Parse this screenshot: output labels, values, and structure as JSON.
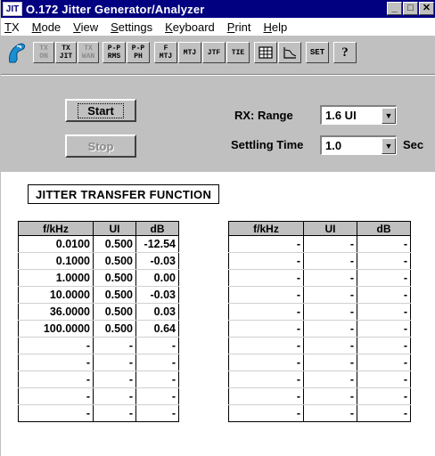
{
  "window": {
    "app_icon_text": "JIT",
    "title": "O.172 Jitter Generator/Analyzer",
    "controls": {
      "minimize": "_",
      "maximize": "□",
      "close": "✕"
    }
  },
  "menu": [
    {
      "label": "TX",
      "key": "T",
      "rest": "X"
    },
    {
      "label": "Mode",
      "key": "M",
      "rest": "ode"
    },
    {
      "label": "View",
      "key": "V",
      "rest": "iew"
    },
    {
      "label": "Settings",
      "key": "S",
      "rest": "ettings"
    },
    {
      "label": "Keyboard",
      "key": "K",
      "rest": "eyboard"
    },
    {
      "label": "Print",
      "key": "P",
      "rest": "rint"
    },
    {
      "label": "Help",
      "key": "H",
      "rest": "elp"
    }
  ],
  "toolbar": {
    "buttons": [
      {
        "label": "TX\nON",
        "enabled": false
      },
      {
        "label": "TX\nJIT",
        "enabled": true
      },
      {
        "label": "TX\nWAN",
        "enabled": false
      },
      {
        "label": "P-P\nRMS",
        "enabled": true
      },
      {
        "label": "P-P\nPH",
        "enabled": true
      },
      {
        "label": "F\nMTJ",
        "enabled": true
      },
      {
        "label": "MTJ",
        "enabled": true
      },
      {
        "label": "JTF",
        "enabled": true
      },
      {
        "label": "TIE",
        "enabled": true
      },
      {
        "label": "SET",
        "enabled": true
      },
      {
        "label": "?",
        "enabled": true
      }
    ],
    "icons": [
      "logo-icon",
      "grid-icon",
      "graph-icon",
      "help-icon"
    ]
  },
  "controls": {
    "start_label": "Start",
    "stop_label": "Stop",
    "rx_range_label": "RX: Range",
    "rx_range_value": "1.6 UI",
    "settling_label": "Settling Time",
    "settling_value": "1.0",
    "settling_unit": "Sec"
  },
  "section_title": "JITTER TRANSFER FUNCTION",
  "table_left": {
    "headers": [
      "f/kHz",
      "UI",
      "dB"
    ],
    "rows": [
      [
        "0.0100",
        "0.500",
        "-12.54"
      ],
      [
        "0.1000",
        "0.500",
        "-0.03"
      ],
      [
        "1.0000",
        "0.500",
        "0.00"
      ],
      [
        "10.0000",
        "0.500",
        "-0.03"
      ],
      [
        "36.0000",
        "0.500",
        "0.03"
      ],
      [
        "100.0000",
        "0.500",
        "0.64"
      ],
      [
        "-",
        "-",
        "-"
      ],
      [
        "-",
        "-",
        "-"
      ],
      [
        "-",
        "-",
        "-"
      ],
      [
        "-",
        "-",
        "-"
      ],
      [
        "-",
        "-",
        "-"
      ]
    ]
  },
  "table_right": {
    "headers": [
      "f/kHz",
      "UI",
      "dB"
    ],
    "rows": [
      [
        "-",
        "-",
        "-"
      ],
      [
        "-",
        "-",
        "-"
      ],
      [
        "-",
        "-",
        "-"
      ],
      [
        "-",
        "-",
        "-"
      ],
      [
        "-",
        "-",
        "-"
      ],
      [
        "-",
        "-",
        "-"
      ],
      [
        "-",
        "-",
        "-"
      ],
      [
        "-",
        "-",
        "-"
      ],
      [
        "-",
        "-",
        "-"
      ],
      [
        "-",
        "-",
        "-"
      ],
      [
        "-",
        "-",
        "-"
      ]
    ]
  }
}
